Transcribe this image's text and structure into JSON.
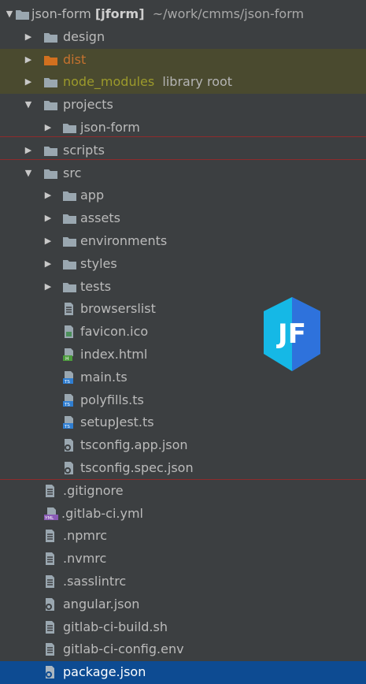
{
  "root": {
    "name": "json-form",
    "module": "[jform]",
    "path": "~/work/cmms/json-form"
  },
  "items": {
    "design": "design",
    "dist": "dist",
    "node_modules": "node_modules",
    "node_modules_note": "library root",
    "projects": "projects",
    "json_form": "json-form",
    "scripts": "scripts",
    "src": "src",
    "app": "app",
    "assets": "assets",
    "environments": "environments",
    "styles": "styles",
    "tests": "tests",
    "browserslist": "browserslist",
    "favicon": "favicon.ico",
    "index_html": "index.html",
    "main_ts": "main.ts",
    "polyfills_ts": "polyfills.ts",
    "setupjest_ts": "setupJest.ts",
    "tsconfig_app": "tsconfig.app.json",
    "tsconfig_spec": "tsconfig.spec.json",
    "gitignore": ".gitignore",
    "gitlab_ci": ".gitlab-ci.yml",
    "npmrc": ".npmrc",
    "nvmrc": ".nvmrc",
    "sasslintrc": ".sasslintrc",
    "angular_json": "angular.json",
    "ci_build": "gitlab-ci-build.sh",
    "ci_config": "gitlab-ci-config.env",
    "package_json": "package.json"
  },
  "logo": {
    "text": "JF"
  },
  "colors": {
    "background": "#3c3f41",
    "selected": "#0d4b92",
    "excluded_text": "#c5722e",
    "library_text": "#9c9a2b",
    "logo_left": "#15b8e6",
    "logo_right": "#2e72dc"
  }
}
